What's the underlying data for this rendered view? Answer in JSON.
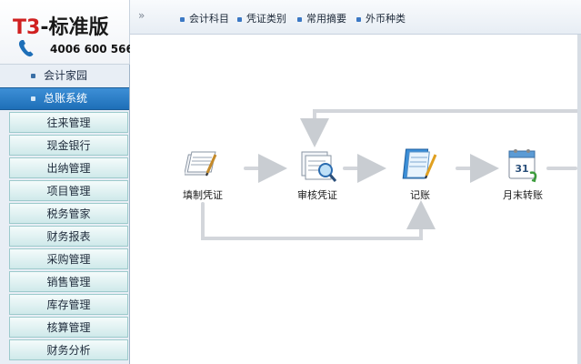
{
  "logo": {
    "brand_t3": "T3",
    "brand_rest": "-标准版",
    "phone": "4006 600 566"
  },
  "sidebar": {
    "groups": [
      {
        "label": "会计家园",
        "active": false
      },
      {
        "label": "总账系统",
        "active": true
      }
    ],
    "items": [
      {
        "label": "往来管理"
      },
      {
        "label": "现金银行"
      },
      {
        "label": "出纳管理"
      },
      {
        "label": "项目管理"
      },
      {
        "label": "税务管家"
      },
      {
        "label": "财务报表"
      },
      {
        "label": "采购管理"
      },
      {
        "label": "销售管理"
      },
      {
        "label": "库存管理"
      },
      {
        "label": "核算管理"
      },
      {
        "label": "财务分析"
      }
    ]
  },
  "toolbar": {
    "chevrons": "»",
    "items": [
      {
        "label": "会计科目"
      },
      {
        "label": "凭证类别"
      },
      {
        "label": "常用摘要"
      },
      {
        "label": "外币种类"
      }
    ]
  },
  "flow": {
    "nodes": [
      {
        "label": "填制凭证",
        "icon": "fill-voucher-icon"
      },
      {
        "label": "审核凭证",
        "icon": "review-voucher-icon"
      },
      {
        "label": "记账",
        "icon": "bookkeeping-icon"
      },
      {
        "label": "月末转账",
        "icon": "month-end-transfer-icon"
      }
    ]
  },
  "colors": {
    "accent": "#1e6fb8",
    "sidebar_item_bg": "#cfe9ea",
    "flow_line": "#cfd3d8"
  }
}
